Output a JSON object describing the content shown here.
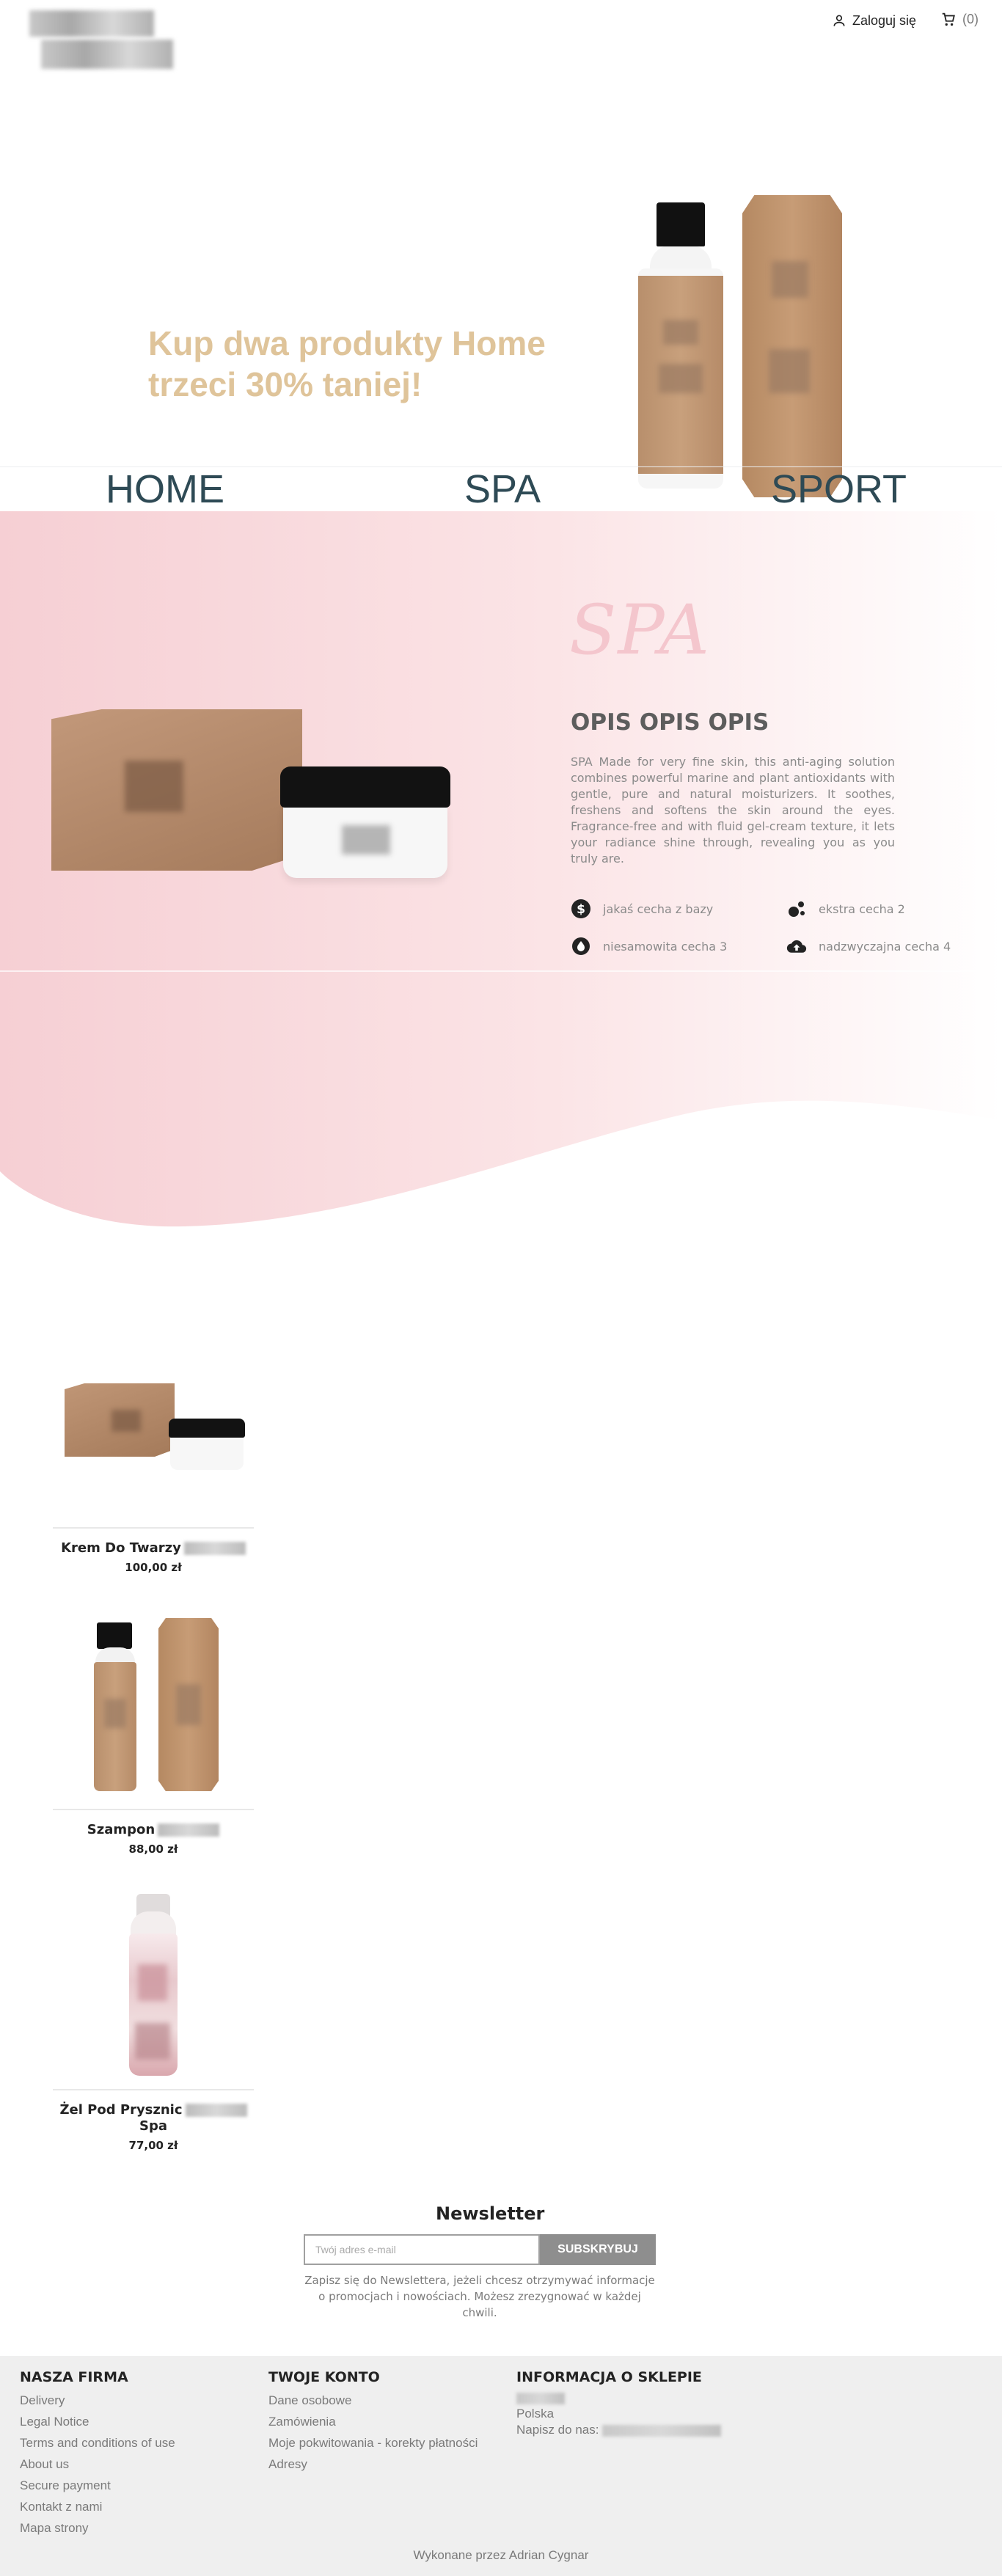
{
  "header": {
    "login_label": "Zaloguj się",
    "cart_count": "(0)"
  },
  "promo": {
    "line1": "Kup dwa produkty Home",
    "line2": "trzeci 30% taniej!"
  },
  "categories": [
    {
      "label": "HOME"
    },
    {
      "label": "SPA"
    },
    {
      "label": "SPORT"
    }
  ],
  "spa": {
    "script_title": "SPA",
    "title": "OPIS OPIS OPIS",
    "description": "SPA Made for very fine skin, this anti-aging solution combines powerful marine and plant antioxidants with gentle, pure and natural moisturizers. It soothes, freshens and softens the skin around the eyes. Fragrance-free and with fluid gel-cream texture, it lets your radiance shine through, revealing you as you truly are.",
    "features": [
      {
        "icon": "dollar-circle-icon",
        "label": "jakaś cecha z bazy"
      },
      {
        "icon": "bubbles-icon",
        "label": "ekstra cecha 2"
      },
      {
        "icon": "drop-icon",
        "label": "niesamowita cecha 3"
      },
      {
        "icon": "cloud-upload-icon",
        "label": "nadzwyczajna cecha 4"
      }
    ]
  },
  "products": [
    {
      "name": "Krem Do Twarzy",
      "price": "100,00 zł"
    },
    {
      "name": "Szampon",
      "price": "88,00 zł"
    },
    {
      "name_line1": "Żel Pod Prysznic",
      "name_line2": "Spa",
      "price": "77,00 zł"
    }
  ],
  "newsletter": {
    "title": "Newsletter",
    "placeholder": "Twój adres e-mail",
    "button": "SUBSKRYBUJ",
    "info": "Zapisz się do Newslettera, jeżeli chcesz otrzymywać informacje o promocjach i nowościach. Możesz zrezygnować w każdej chwili."
  },
  "footer": {
    "company": {
      "title": "NASZA FIRMA",
      "links": [
        "Delivery",
        "Legal Notice",
        "Terms and conditions of use",
        "About us",
        "Secure payment",
        "Kontakt z nami",
        "Mapa strony"
      ]
    },
    "account": {
      "title": "TWOJE KONTO",
      "links": [
        "Dane osobowe",
        "Zamówienia",
        "Moje pokwitowania - korekty płatności",
        "Adresy"
      ]
    },
    "store": {
      "title": "INFORMACJA O SKLEPIE",
      "country": "Polska",
      "email_label": "Napisz do nas:"
    },
    "credit": "Wykonane przez Adrian Cygnar"
  },
  "colors": {
    "promo_text": "#dfc49a",
    "category_nav": "#2e4a55",
    "spa_pink": "#f4c6cd",
    "subscribe_button": "#8e8e8e",
    "footer_bg": "#efefef"
  }
}
